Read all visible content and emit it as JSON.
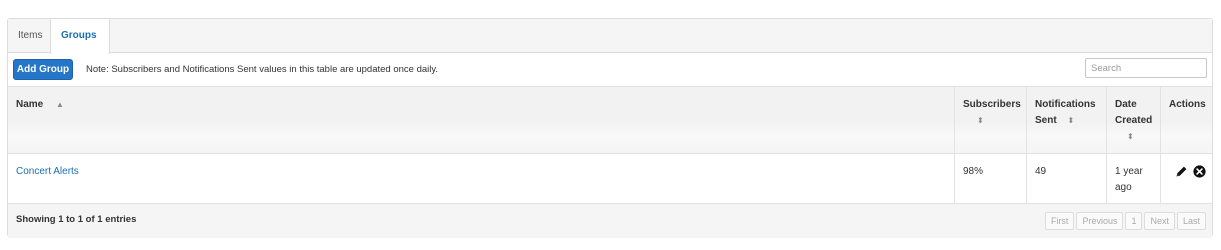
{
  "tabs": [
    {
      "label": "Items",
      "active": false
    },
    {
      "label": "Groups",
      "active": true
    }
  ],
  "toolbar": {
    "add_label": "Add Group",
    "note": "Note: Subscribers and Notifications Sent values in this table are updated once daily.",
    "search_placeholder": "Search"
  },
  "table": {
    "columns": {
      "name": "Name",
      "subscribers": "Subscribers",
      "notifications_1": "Notifications",
      "notifications_2": "Sent",
      "date_1": "Date",
      "date_2": "Created",
      "actions": "Actions"
    },
    "sort_icons": {
      "asc": "▲",
      "both": "⬍"
    },
    "rows": [
      {
        "name": "Concert Alerts",
        "subscribers": "98%",
        "notifications_sent": "49",
        "date_created_1": "1 year",
        "date_created_2": "ago"
      }
    ]
  },
  "icons": {
    "edit": "pencil-icon",
    "delete": "close-circle-icon"
  },
  "footer": {
    "showing": "Showing 1 to 1 of 1 entries",
    "pagination": {
      "first": "First",
      "previous": "Previous",
      "page": "1",
      "next": "Next",
      "last": "Last"
    }
  },
  "colors": {
    "accent": "#2576c9",
    "link": "#1a6fb5"
  }
}
